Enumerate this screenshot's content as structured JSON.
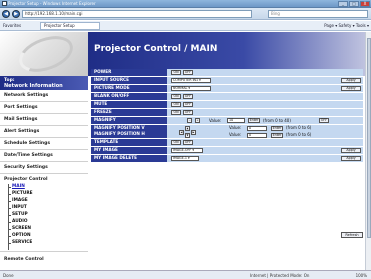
{
  "window": {
    "title": "Projector Setup - Windows Internet Explorer",
    "controls": [
      "_",
      "□",
      "X"
    ]
  },
  "address": {
    "back": "◀",
    "forward": "▶",
    "url": "http://192.168.1.10/main.cgi",
    "search_placeholder": "Bing"
  },
  "tabs": {
    "favorites": "Favorites",
    "active_tab": "Projector Setup",
    "command_bar": "Page ▾  Safety ▾  Tools ▾"
  },
  "page": {
    "title": "Projector Control / MAIN"
  },
  "sidebar": {
    "top_line1": "Top:",
    "top_line2": "Network Information",
    "items": [
      "Network Settings",
      "Port Settings",
      "Mail Settings",
      "Alert Settings",
      "Schedule Settings",
      "Date/Time Settings",
      "Security Settings",
      "Projector Control"
    ],
    "sub_items": [
      "MAIN",
      "PICTURE",
      "IMAGE",
      "INPUT",
      "SETUP",
      "AUDIO",
      "SCREEN",
      "OPTION",
      "SERVICE"
    ],
    "bottom_item": "Remote Control"
  },
  "controls": {
    "on": "ON",
    "off": "OFF",
    "apply": "Apply",
    "enter": "Enter",
    "refresh": "Refresh",
    "rows": {
      "power": "POWER",
      "input_source": "INPUT SOURCE",
      "input_source_value": "COMPUTER IN1 ▾",
      "picture_mode": "PICTURE MODE",
      "picture_mode_value": "NORMAL ▾",
      "blank": "BLANK ON/OFF",
      "mute": "MUTE",
      "freeze": "FREEZE",
      "magnify": "MAGNIFY",
      "magnify_value_label": "Value:",
      "magnify_value": "10",
      "magnify_range": "(from 0 to 40)",
      "magnify_pos_v": "MAGNIFY POSITION V",
      "magnify_pos_h": "MAGNIFY POSITION H",
      "pos_value_label": "Value:",
      "pos_v_value": "0",
      "pos_h_value": "0",
      "pos_range": "(from 0 to 6)",
      "template": "TEMPLATE",
      "my_image": "MY IMAGE",
      "my_image_value": "IMAGE-OFF ▾",
      "my_image_delete": "MY IMAGE DELETE",
      "my_image_delete_value": "IMAGE-1 ▾"
    }
  },
  "status": {
    "left": "Done",
    "zone": "Internet | Protected Mode: On",
    "zoom": "100%"
  }
}
